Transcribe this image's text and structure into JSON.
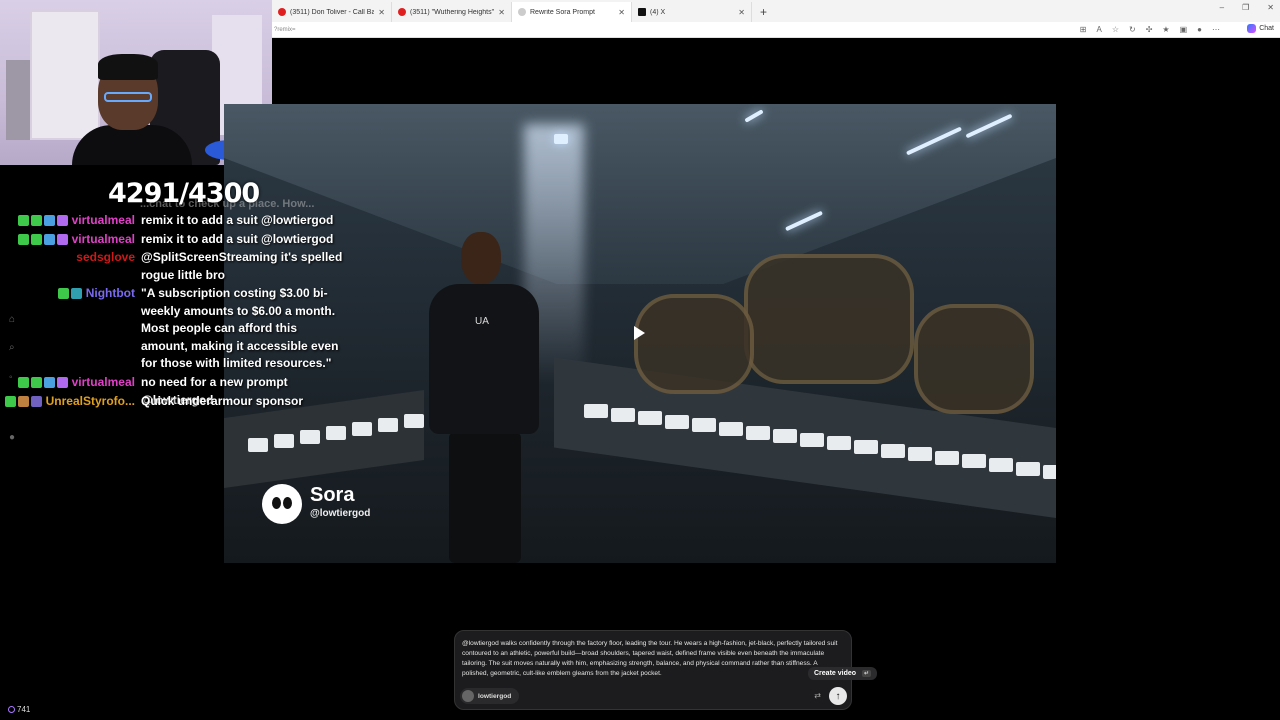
{
  "browser": {
    "tabs": [
      {
        "label": "(3511) Don Toliver - Call Back [Offi",
        "favicon_color": "#e02020",
        "active": false
      },
      {
        "label": "(3511) \"Wuthering Heights\" | Offi",
        "favicon_color": "#e02020",
        "active": false
      },
      {
        "label": "Rewrite Sora Prompt",
        "favicon_color": "#cccccc",
        "active": true
      },
      {
        "label": "(4) X",
        "favicon_color": "#111111",
        "active": false
      }
    ],
    "new_tab": "+",
    "url": "?remix=",
    "chat_label": "Chat",
    "controls": {
      "minimize": "–",
      "restore": "❐",
      "close": "✕"
    }
  },
  "stream": {
    "counter": "4291/4300",
    "scroll_ghost": "...chat to check up a place. How...",
    "viewer_count": "741"
  },
  "chat_messages": [
    {
      "user": "virtualmeal",
      "color": "#e040c8",
      "badges": [
        "#3ec94a",
        "#3ec94a",
        "#4aa0e0",
        "#b06af0"
      ],
      "text": "remix it to add a suit @lowtiergod"
    },
    {
      "user": "virtualmeal",
      "color": "#e040c8",
      "badges": [
        "#3ec94a",
        "#3ec94a",
        "#4aa0e0",
        "#b06af0"
      ],
      "text": "remix it to add a suit @lowtiergod"
    },
    {
      "user": "sedsglove",
      "color": "#d01818",
      "badges": [],
      "text": "@SplitScreenStreaming it's spelled rogue little bro"
    },
    {
      "user": "Nightbot",
      "color": "#7a6af0",
      "badges": [
        "#3ec94a",
        "#30a0b0"
      ],
      "text": "\"A subscription costing $3.00 bi-weekly amounts to $6.00 a month. Most people can afford this amount, making it accessible even for those with limited resources.\""
    },
    {
      "user": "virtualmeal",
      "color": "#e040c8",
      "badges": [
        "#3ec94a",
        "#3ec94a",
        "#4aa0e0",
        "#b06af0"
      ],
      "text": "no need for a new prompt @lowtiergod"
    },
    {
      "user": "UnrealStyrofo...",
      "color": "#e0a020",
      "badges": [
        "#3ec94a",
        "#c08040",
        "#7060c0"
      ],
      "text": "Quick underarmour sponsor"
    }
  ],
  "video": {
    "brand": "Sora",
    "handle": "@lowtiergod",
    "shirt_logo": "UA"
  },
  "prompt": {
    "text": "@lowtiergod walks confidently through the factory floor, leading the tour. He wears a high-fashion, jet-black, perfectly tailored suit contoured to an athletic, powerful build—broad shoulders, tapered waist, defined frame visible even beneath the immaculate tailoring. The suit moves naturally with him, emphasizing strength, balance, and physical command rather than stiffness. A polished, geometric, cult-like emblem gleams from the jacket pocket.",
    "username": "lowtiergod",
    "tooltip": "Create video",
    "tooltip_key": "↵",
    "send_icon": "↑",
    "remix_icon": "⇄"
  }
}
